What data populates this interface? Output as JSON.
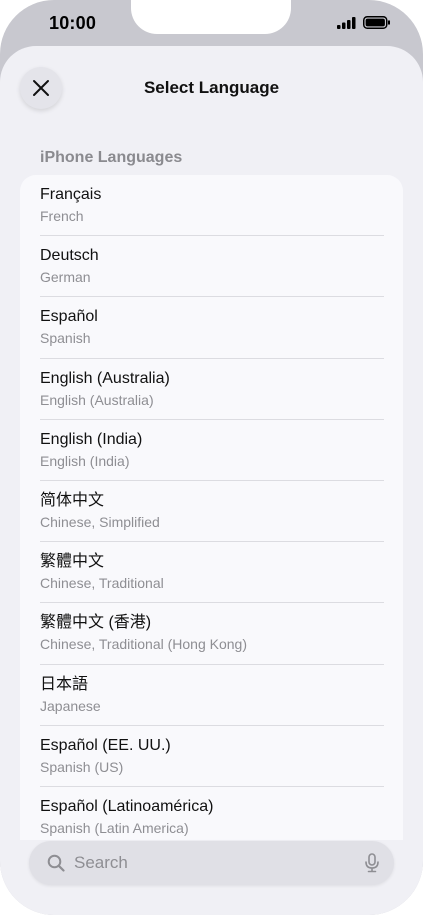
{
  "status_bar": {
    "time": "10:00"
  },
  "sheet": {
    "title": "Select Language",
    "close_icon": "close-icon"
  },
  "section": {
    "header": "iPhone Languages"
  },
  "languages": [
    {
      "native": "Français",
      "english": "French"
    },
    {
      "native": "Deutsch",
      "english": "German"
    },
    {
      "native": "Español",
      "english": "Spanish"
    },
    {
      "native": "English (Australia)",
      "english": "English (Australia)"
    },
    {
      "native": "English (India)",
      "english": "English (India)"
    },
    {
      "native": "简体中文",
      "english": "Chinese, Simplified"
    },
    {
      "native": "繁體中文",
      "english": "Chinese, Traditional"
    },
    {
      "native": "繁體中文 (香港)",
      "english": "Chinese, Traditional (Hong Kong)"
    },
    {
      "native": "日本語",
      "english": "Japanese"
    },
    {
      "native": "Español (EE. UU.)",
      "english": "Spanish (US)"
    },
    {
      "native": "Español (Latinoamérica)",
      "english": "Spanish (Latin America)"
    }
  ],
  "search": {
    "placeholder": "Search",
    "value": "",
    "search_icon": "search-icon",
    "mic_icon": "microphone-icon"
  },
  "colors": {
    "shell": "#c8c8cf",
    "sheet_background": "#f0f0f5",
    "card_background": "#f9f9fc",
    "primary_text": "#111111",
    "secondary_text": "#8e8e93"
  }
}
